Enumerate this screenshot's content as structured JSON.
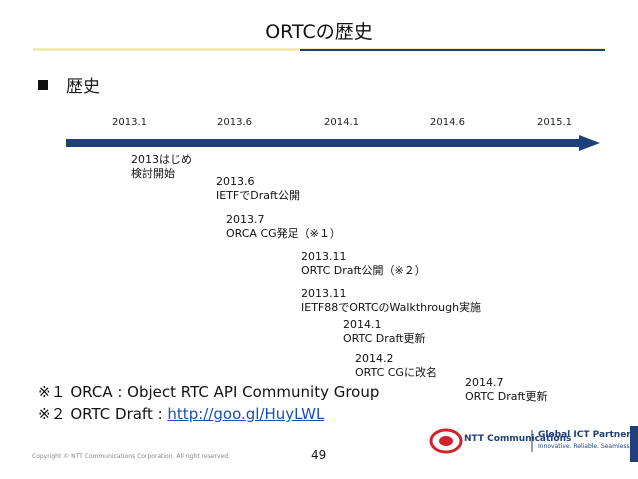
{
  "slide": {
    "title": "ORTCの歴史",
    "bullet": "歴史",
    "timeline": {
      "ticks": [
        "2013.1",
        "2013.6",
        "2014.1",
        "2014.6",
        "2015.1"
      ],
      "events": [
        {
          "date": "2013はじめ",
          "text": "検討開始"
        },
        {
          "date": "2013.6",
          "text": "IETFでDraft公開"
        },
        {
          "date": "2013.7",
          "text": "ORCA CG発足（※１）"
        },
        {
          "date": "2013.11",
          "text": "ORTC Draft公開（※２）"
        },
        {
          "date": "2013.11",
          "text": "IETF88でORTCのWalkthrough実施"
        },
        {
          "date": "2014.1",
          "text": "ORTC Draft更新"
        },
        {
          "date": "2014.2",
          "text": "ORTC CGに改名"
        },
        {
          "date": "2014.7",
          "text": "ORTC Draft更新"
        }
      ]
    },
    "footnotes": [
      {
        "mark": "※１",
        "text": "ORCA : Object RTC API Community Group",
        "link": ""
      },
      {
        "mark": "※２",
        "text": "ORTC Draft : ",
        "link": "http://goo.gl/HuyLWL"
      }
    ],
    "copyright": "Copyright © NTT Communications Corporation. All right reserved.",
    "page_number": "49",
    "logo": {
      "name": "NTT Communications",
      "tagline_title": "Global ICT Partner",
      "tagline_sub": "Innovative. Reliable. Seamless."
    },
    "colors": {
      "accent": "#1f3f7a",
      "title_rule": "#f2e9b8",
      "link": "#1a4fb5",
      "logo_red": "#d1232a"
    }
  }
}
